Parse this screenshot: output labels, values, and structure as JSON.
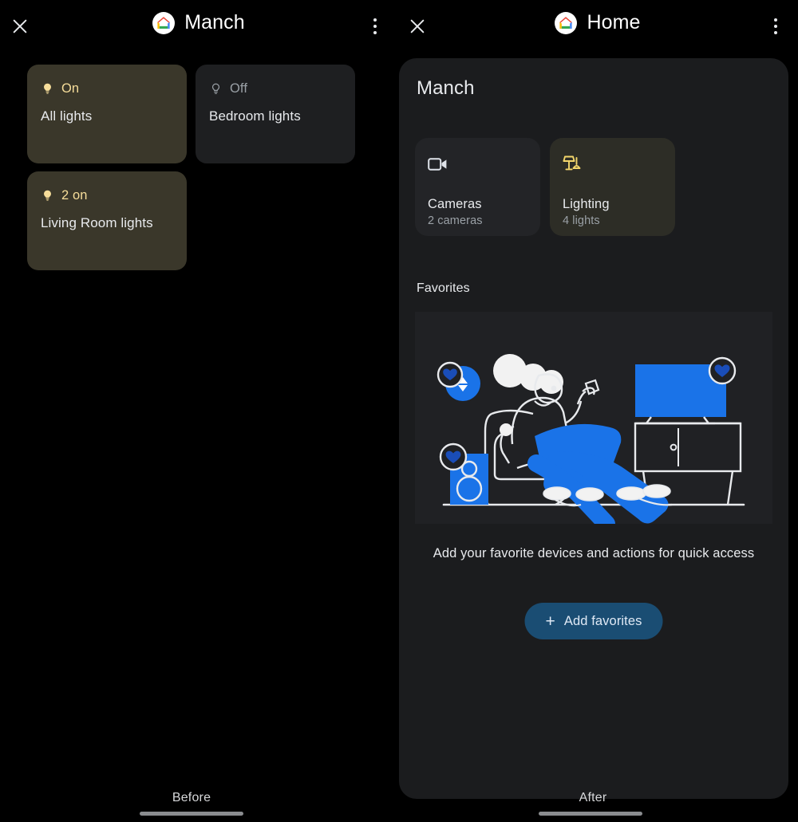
{
  "left_panel": {
    "appbar": {
      "close_icon": "close-icon",
      "logo_icon": "google-home-logo",
      "title": "Manch",
      "more_icon": "overflow-menu-icon"
    },
    "tiles": [
      {
        "status": "On",
        "name": "All lights",
        "state": "on",
        "icon": "lightbulb-filled-icon"
      },
      {
        "status": "Off",
        "name": "Bedroom lights",
        "state": "off",
        "icon": "lightbulb-outline-icon"
      },
      {
        "status": "2 on",
        "name": "Living Room lights",
        "state": "on",
        "icon": "lightbulb-filled-icon"
      }
    ],
    "caption": "Before"
  },
  "right_panel": {
    "appbar": {
      "close_icon": "close-icon",
      "logo_icon": "google-home-logo",
      "title": "Home",
      "more_icon": "overflow-menu-icon"
    },
    "sheet": {
      "title": "Manch",
      "tiles": [
        {
          "icon": "video-camera-icon",
          "label": "Cameras",
          "sub": "2 cameras"
        },
        {
          "icon": "lamp-icon",
          "label": "Lighting",
          "sub": "4 lights"
        }
      ],
      "favorites": {
        "heading": "Favorites",
        "illustration": "person-on-couch-with-devices-illustration",
        "description": "Add your favorite devices and actions for quick access",
        "button_label": "Add favorites",
        "button_icon": "plus-icon"
      }
    },
    "caption": "After"
  },
  "colors": {
    "background": "#000000",
    "sheet": "#1b1c1e",
    "tile_on": "#3a372a",
    "tile_off": "#1e1f21",
    "tile_camera": "#232427",
    "tile_lighting": "#2d2d26",
    "accent_yellow": "#f6dd9a",
    "accent_blue": "#1a73e8",
    "button_blue": "#1a4d73",
    "text_primary": "#e8eaed",
    "text_secondary": "#9aa0a6"
  }
}
